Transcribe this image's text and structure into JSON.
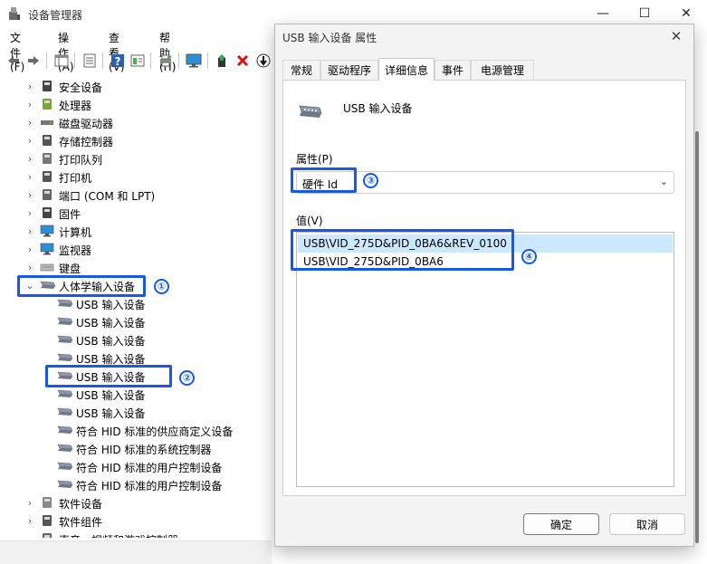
{
  "window": {
    "title": "设备管理器",
    "controls": {
      "minimize": "—",
      "maximize": "☐",
      "close": "✕"
    }
  },
  "menu": [
    "文件(F)",
    "操作(A)",
    "查看(V)",
    "帮助(H)"
  ],
  "tree": {
    "items": [
      {
        "label": "安全设备",
        "icon": "security-device-icon",
        "expanded": false
      },
      {
        "label": "处理器",
        "icon": "processor-icon",
        "expanded": false
      },
      {
        "label": "磁盘驱动器",
        "icon": "disk-drive-icon",
        "expanded": false
      },
      {
        "label": "存储控制器",
        "icon": "storage-controller-icon",
        "expanded": false
      },
      {
        "label": "打印队列",
        "icon": "print-queue-icon",
        "expanded": false
      },
      {
        "label": "打印机",
        "icon": "printer-icon",
        "expanded": false
      },
      {
        "label": "端口 (COM 和 LPT)",
        "icon": "port-icon",
        "expanded": false
      },
      {
        "label": "固件",
        "icon": "firmware-icon",
        "expanded": false
      },
      {
        "label": "计算机",
        "icon": "computer-icon",
        "expanded": false
      },
      {
        "label": "监视器",
        "icon": "monitor-icon",
        "expanded": false
      },
      {
        "label": "键盘",
        "icon": "keyboard-icon",
        "expanded": false
      },
      {
        "label": "人体学输入设备",
        "icon": "hid-icon",
        "expanded": true
      }
    ],
    "hid_children": [
      "USB 输入设备",
      "USB 输入设备",
      "USB 输入设备",
      "USB 输入设备",
      "USB 输入设备",
      "USB 输入设备",
      "USB 输入设备",
      "符合 HID 标准的供应商定义设备",
      "符合 HID 标准的系统控制器",
      "符合 HID 标准的用户控制设备",
      "符合 HID 标准的用户控制设备"
    ],
    "after_items": [
      {
        "label": "软件设备",
        "icon": "software-device-icon"
      },
      {
        "label": "软件组件",
        "icon": "software-component-icon"
      },
      {
        "label": "声音、视频和游戏控制器",
        "icon": "sound-icon"
      }
    ]
  },
  "annotations": {
    "badge_1": "①",
    "badge_2": "②",
    "badge_3": "③",
    "badge_4": "④",
    "color": "#1559e6"
  },
  "dialog": {
    "title": "USB 输入设备 属性",
    "close": "✕",
    "tabs": [
      "常规",
      "驱动程序",
      "详细信息",
      "事件",
      "电源管理"
    ],
    "active_tab": "详细信息",
    "device_name": "USB 输入设备",
    "property_label": "属性(P)",
    "property_value": "硬件 Id",
    "value_label": "值(V)",
    "values": [
      "USB\\VID_275D&PID_0BA6&REV_0100",
      "USB\\VID_275D&PID_0BA6"
    ],
    "ok_label": "确定",
    "cancel_label": "取消"
  }
}
